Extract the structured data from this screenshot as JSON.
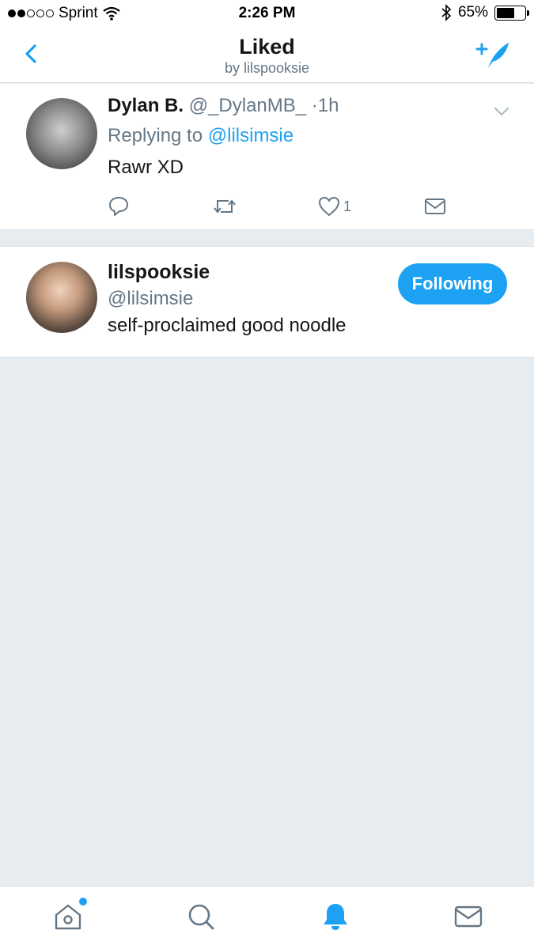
{
  "status_bar": {
    "carrier": "Sprint",
    "time": "2:26 PM",
    "battery": "65%",
    "battery_level": 0.65
  },
  "header": {
    "title": "Liked",
    "subtitle": "by lilspooksie"
  },
  "tweet": {
    "name": "Dylan B.",
    "handle": "@_DylanMB_",
    "separator": "·",
    "time": "1h",
    "reply_prefix": "Replying to",
    "reply_handle": "@lilsimsie",
    "text": "Rawr XD",
    "like_count": "1"
  },
  "user": {
    "name": "lilspooksie",
    "handle": "@lilsimsie",
    "bio": "self-proclaimed good noodle",
    "follow_label": "Following"
  },
  "colors": {
    "accent": "#1da1f2",
    "background": "#e6ecf0",
    "secondary_text": "#657786"
  },
  "icons": {
    "back": "chevron-left-icon",
    "compose": "compose-tweet-icon",
    "caret": "chevron-down-icon",
    "reply": "reply-icon",
    "retweet": "retweet-icon",
    "like": "heart-icon",
    "dm": "envelope-icon",
    "home": "home-icon",
    "search": "search-icon",
    "notifications": "bell-icon",
    "messages": "envelope-icon"
  }
}
